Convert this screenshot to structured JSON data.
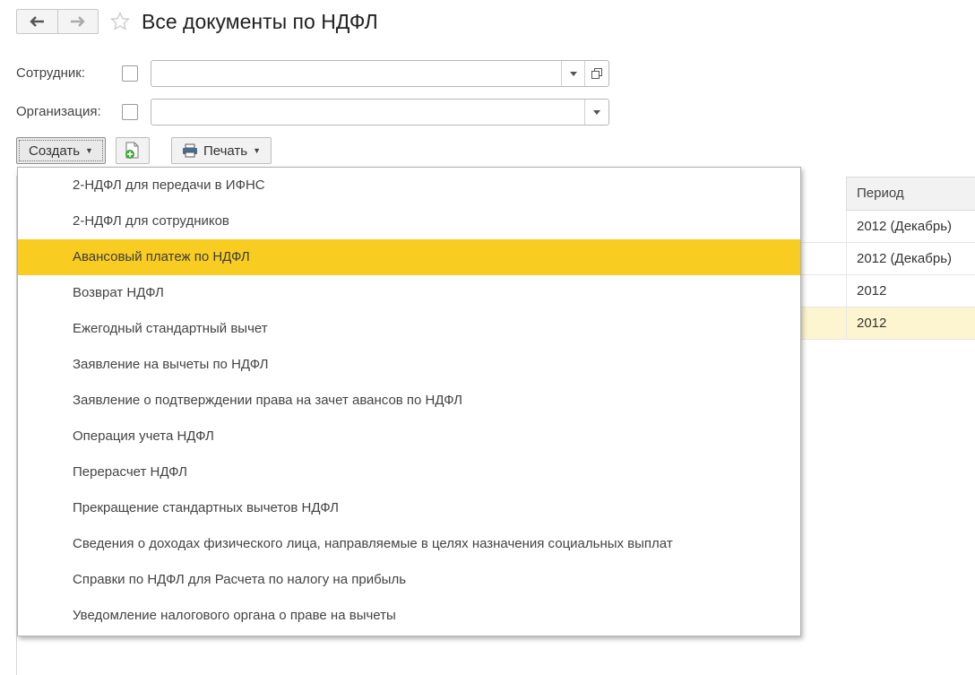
{
  "header": {
    "title": "Все документы по НДФЛ"
  },
  "filters": {
    "employee_label": "Сотрудник:",
    "employee_value": "",
    "organization_label": "Организация:",
    "organization_value": ""
  },
  "toolbar": {
    "create_label": "Создать",
    "print_label": "Печать"
  },
  "table": {
    "columns": [
      "Период"
    ],
    "rows": [
      {
        "period": "2012 (Декабрь)"
      },
      {
        "period": "2012 (Декабрь)"
      },
      {
        "period": "2012"
      },
      {
        "period": "2012",
        "selected": true
      }
    ]
  },
  "create_menu": {
    "highlighted_index": 2,
    "items": [
      "2-НДФЛ для передачи в ИФНС",
      "2-НДФЛ для сотрудников",
      "Авансовый платеж по НДФЛ",
      "Возврат НДФЛ",
      "Ежегодный стандартный вычет",
      "Заявление на вычеты по НДФЛ",
      "Заявление о подтверждении права на зачет авансов по НДФЛ",
      "Операция учета НДФЛ",
      "Перерасчет НДФЛ",
      "Прекращение стандартных вычетов НДФЛ",
      "Сведения о доходах физического лица, направляемые в целях назначения социальных выплат",
      "Справки по НДФЛ для Расчета по налогу на прибыль",
      "Уведомление налогового органа о праве на вычеты"
    ]
  },
  "colors": {
    "highlight": "#f8cc21",
    "selected_row": "#fdf5cf",
    "add_icon_green": "#3aa935"
  },
  "icons": {
    "back": "arrow-left-icon",
    "forward": "arrow-right-icon",
    "favorite": "star-icon",
    "dropdown": "chevron-down-icon",
    "open": "open-form-icon",
    "add": "document-add-icon",
    "print": "printer-icon"
  }
}
